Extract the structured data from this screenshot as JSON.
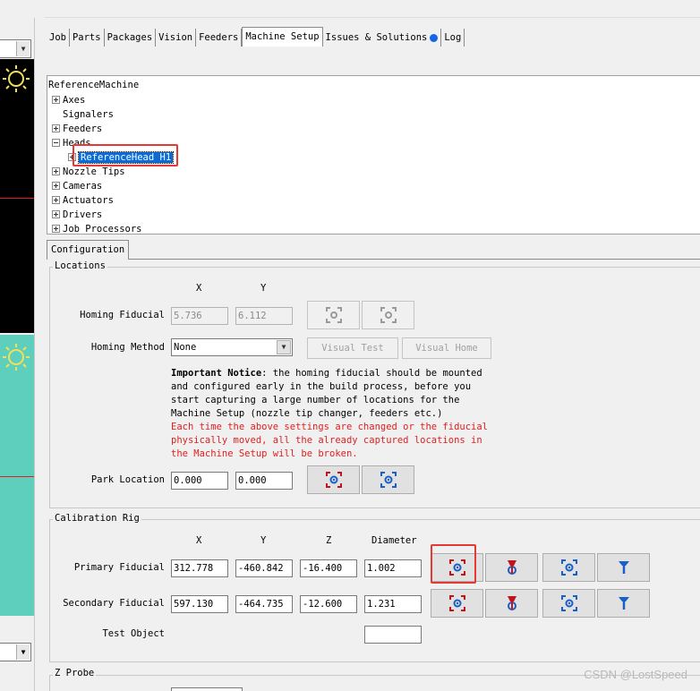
{
  "tabs": [
    {
      "label": "Job"
    },
    {
      "label": "Parts"
    },
    {
      "label": "Packages"
    },
    {
      "label": "Vision"
    },
    {
      "label": "Feeders"
    },
    {
      "label": "Machine Setup",
      "active": true
    },
    {
      "label": "Issues & Solutions",
      "indicator": "blue-dot"
    },
    {
      "label": "Log"
    }
  ],
  "tree": {
    "root": "ReferenceMachine",
    "nodes": [
      {
        "label": "Axes",
        "expander": "plus"
      },
      {
        "label": "Signalers",
        "expander": "none"
      },
      {
        "label": "Feeders",
        "expander": "plus"
      },
      {
        "label": "Heads",
        "expander": "minus"
      },
      {
        "label": "ReferenceHead H1",
        "expander": "plus",
        "selected": true,
        "highlighted": true
      },
      {
        "label": "Nozzle Tips",
        "expander": "plus"
      },
      {
        "label": "Cameras",
        "expander": "plus"
      },
      {
        "label": "Actuators",
        "expander": "plus"
      },
      {
        "label": "Drivers",
        "expander": "plus"
      },
      {
        "label": "Job Processors",
        "expander": "plus"
      }
    ]
  },
  "config_tab": "Configuration",
  "locations": {
    "legend": "Locations",
    "col_x": "X",
    "col_y": "Y",
    "homing_fiducial": {
      "label": "Homing Fiducial",
      "x": "5.736",
      "y": "6.112",
      "disabled": true
    },
    "homing_method": {
      "label": "Homing Method",
      "value": "None"
    },
    "visual_test": "Visual Test",
    "visual_home": "Visual Home",
    "notice_bold": "Important Notice",
    "notice_text": ": the homing fiducial should be mounted and configured early in the build process, before you start capturing a large number of locations for the Machine Setup (nozzle tip changer, feeders etc.)",
    "notice_warning": "Each time the above settings are changed or the fiducial physically moved, all the already captured locations in the Machine Setup will be broken.",
    "park_location": {
      "label": "Park Location",
      "x": "0.000",
      "y": "0.000"
    }
  },
  "calibration_rig": {
    "legend": "Calibration Rig",
    "col_x": "X",
    "col_y": "Y",
    "col_z": "Z",
    "col_diameter": "Diameter",
    "primary": {
      "label": "Primary Fiducial",
      "x": "312.778",
      "y": "-460.842",
      "z": "-16.400",
      "diameter": "1.002"
    },
    "secondary": {
      "label": "Secondary Fiducial",
      "x": "597.130",
      "y": "-464.735",
      "z": "-12.600",
      "diameter": "1.231"
    },
    "test_object": {
      "label": "Test Object",
      "value": ""
    }
  },
  "z_probe": {
    "legend": "Z Probe"
  },
  "watermark": "CSDN @LostSpeed",
  "colors": {
    "selection": "#0a6ad6",
    "highlight_box": "#e53935",
    "warning_text": "#e02020",
    "issue_dot": "#1864e8",
    "icon_blue": "#1a5fc8",
    "icon_red": "#c0141c",
    "camera_bottom": "#5fcfbd"
  }
}
